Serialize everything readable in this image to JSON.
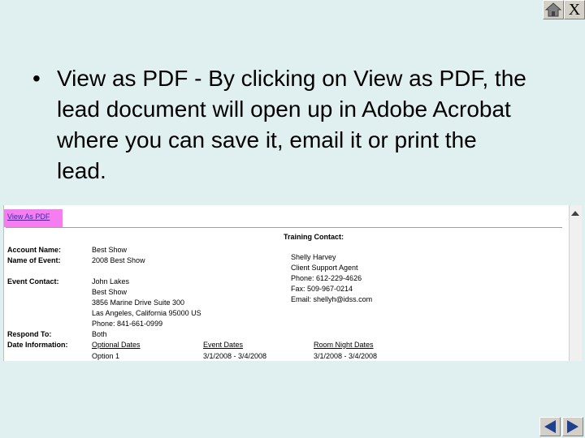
{
  "slide": {
    "close_label": "X",
    "bullet": "•",
    "text": "View as PDF - By clicking on View as PDF, the lead document will open up in Adobe Acrobat where you can save it, email it or print the lead."
  },
  "doc": {
    "view_pdf_link": "View As PDF",
    "training_contact_label": "Training Contact:",
    "trainer": {
      "name": "Shelly Harvey",
      "title": "Client Support Agent",
      "phone": "Phone:  612-229-4626",
      "fax": "Fax:     509-967-0214",
      "email": "Email:   shellyh@idss.com"
    },
    "fields": {
      "account_name_label": "Account Name:",
      "account_name": "Best Show",
      "event_name_label": "Name of Event:",
      "event_name": "2008 Best Show",
      "event_contact_label": "Event Contact:",
      "contact_name": "John  Lakes",
      "contact_company": "Best Show",
      "contact_address1": "3856 Marine Drive Suite 300",
      "contact_address2": "Las Angeles, California 95000 US",
      "contact_phone": "Phone:  841-661-0999",
      "respond_to_label": "Respond To:",
      "respond_to": "Both",
      "date_info_label": "Date Information:"
    },
    "dates": {
      "optional_header": "Optional Dates",
      "event_header": "Event Dates",
      "room_header": "Room Night Dates",
      "optional_value": "Option 1",
      "event_value": "3/1/2008 - 3/4/2008",
      "room_value": "3/1/2008 - 3/4/2008"
    }
  },
  "icons": [
    "home-icon",
    "close-icon",
    "previous-icon",
    "next-icon",
    "scroll-up-icon"
  ]
}
